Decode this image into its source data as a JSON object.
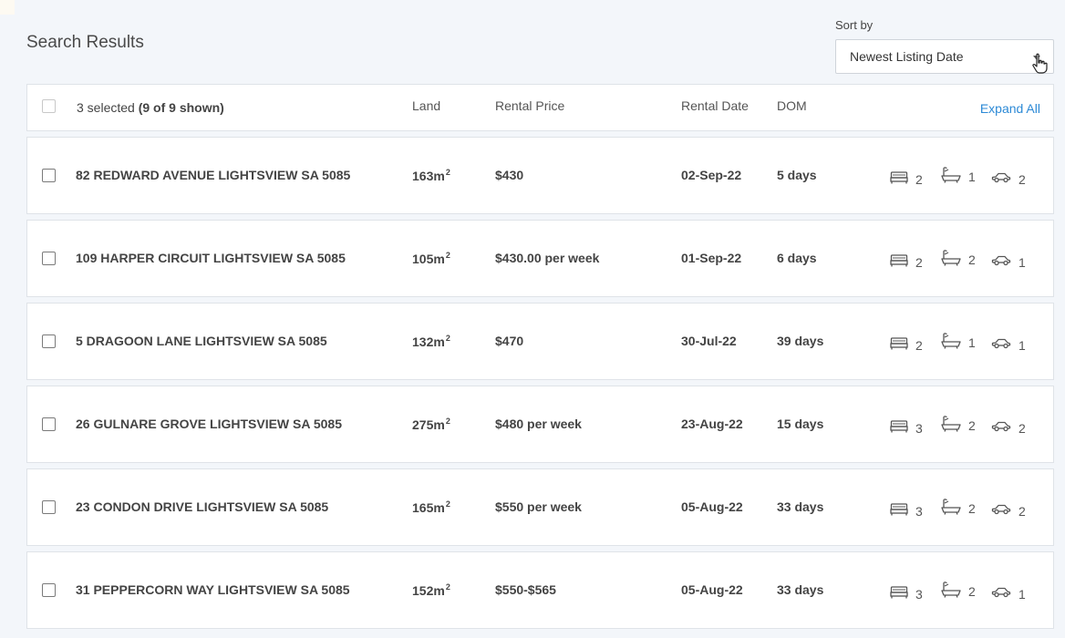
{
  "page": {
    "title": "Search Results"
  },
  "sort": {
    "label": "Sort by",
    "value": "Newest Listing Date"
  },
  "header": {
    "selected_text": "3 selected",
    "shown_text": "(9 of 9 shown)",
    "columns": {
      "land": "Land",
      "rental_price": "Rental Price",
      "rental_date": "Rental Date",
      "dom": "DOM"
    },
    "expand_all": "Expand All"
  },
  "rows": [
    {
      "address": "82 REDWARD AVENUE LIGHTSVIEW SA 5085",
      "land": "163m",
      "land_sup": "2",
      "price": "$430",
      "date": "02-Sep-22",
      "dom": "5 days",
      "beds": "2",
      "baths": "1",
      "cars": "2"
    },
    {
      "address": "109 HARPER CIRCUIT LIGHTSVIEW SA 5085",
      "land": "105m",
      "land_sup": "2",
      "price": "$430.00 per week",
      "date": "01-Sep-22",
      "dom": "6 days",
      "beds": "2",
      "baths": "2",
      "cars": "1"
    },
    {
      "address": "5 DRAGOON LANE LIGHTSVIEW SA 5085",
      "land": "132m",
      "land_sup": "2",
      "price": "$470",
      "date": "30-Jul-22",
      "dom": "39 days",
      "beds": "2",
      "baths": "1",
      "cars": "1"
    },
    {
      "address": "26 GULNARE GROVE LIGHTSVIEW SA 5085",
      "land": "275m",
      "land_sup": "2",
      "price": "$480 per week",
      "date": "23-Aug-22",
      "dom": "15 days",
      "beds": "3",
      "baths": "2",
      "cars": "2"
    },
    {
      "address": "23 CONDON DRIVE LIGHTSVIEW SA 5085",
      "land": "165m",
      "land_sup": "2",
      "price": "$550 per week",
      "date": "05-Aug-22",
      "dom": "33 days",
      "beds": "3",
      "baths": "2",
      "cars": "2"
    },
    {
      "address": "31 PEPPERCORN WAY LIGHTSVIEW SA 5085",
      "land": "152m",
      "land_sup": "2",
      "price": "$550-$565",
      "date": "05-Aug-22",
      "dom": "33 days",
      "beds": "3",
      "baths": "2",
      "cars": "1"
    }
  ],
  "colors": {
    "accent": "#2d8ad6",
    "background": "#f3f6fa",
    "card": "#ffffff",
    "border": "#dfe3e8"
  },
  "icons": {
    "bed": "bed-icon",
    "bath": "bath-icon",
    "car": "car-icon",
    "cursor": "hand-cursor-icon"
  }
}
